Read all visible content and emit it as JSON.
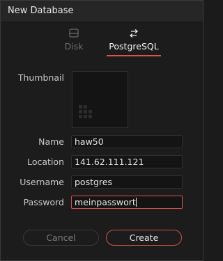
{
  "dialog": {
    "title": "New Database"
  },
  "tabs": [
    {
      "label": "Disk",
      "icon": "disk-icon",
      "active": false
    },
    {
      "label": "PostgreSQL",
      "icon": "swap-arrows-icon",
      "active": true
    }
  ],
  "form": {
    "thumbnail_label": "Thumbnail",
    "name_label": "Name",
    "name_value": "haw50",
    "location_label": "Location",
    "location_value": "141.62.111.121",
    "username_label": "Username",
    "username_value": "postgres",
    "password_label": "Password",
    "password_value": "meinpasswort"
  },
  "buttons": {
    "cancel": "Cancel",
    "create": "Create"
  },
  "colors": {
    "accent": "#d9534f",
    "background": "#1c1c1c",
    "field_bg": "#141414"
  }
}
